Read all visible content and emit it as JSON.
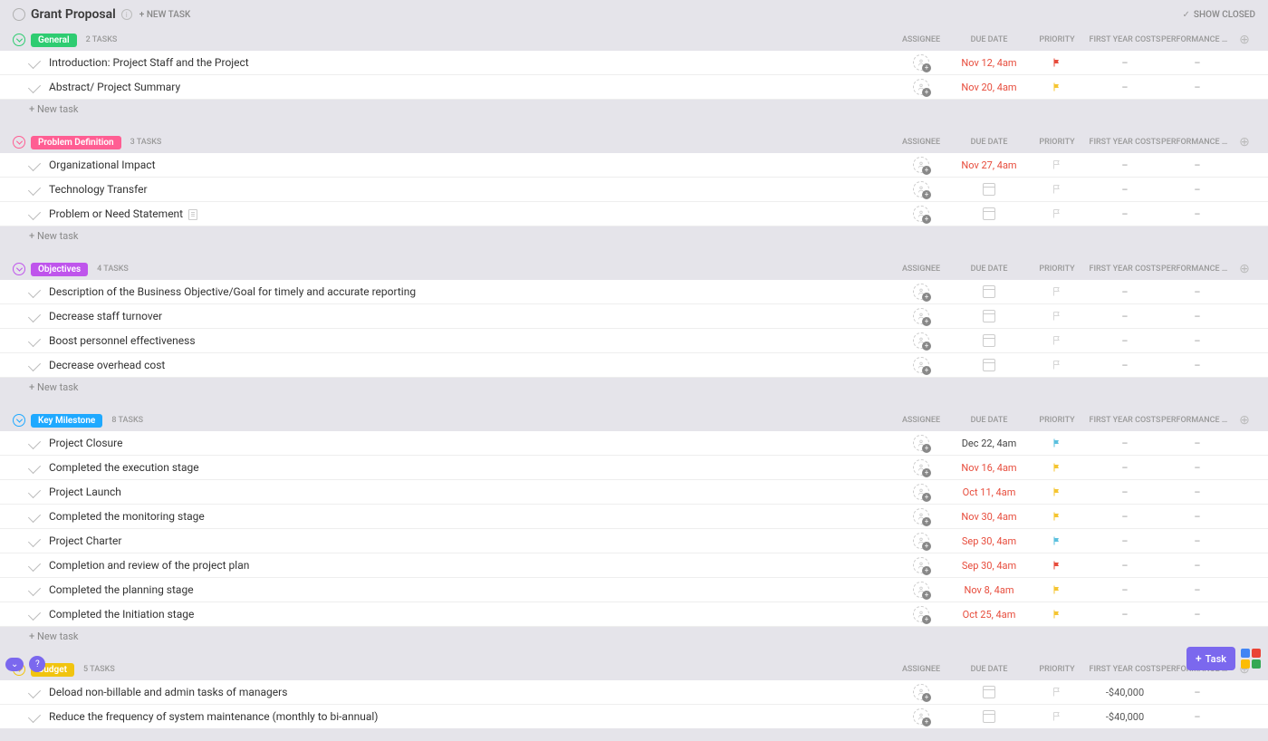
{
  "header": {
    "title": "Grant Proposal",
    "new_task": "+ NEW TASK",
    "show_closed": "SHOW CLOSED"
  },
  "columns": {
    "assignee": "ASSIGNEE",
    "due_date": "DUE DATE",
    "priority": "PRIORITY",
    "first_year": "FIRST YEAR COSTS",
    "performance": "PERFORMANCE M..."
  },
  "new_task_label": "+ New task",
  "fab": {
    "task": "Task"
  },
  "colors": {
    "general": "#2ecc71",
    "problem": "#ff5e93",
    "objectives": "#bf55ec",
    "milestone": "#1fa9ff",
    "budget": "#f1c40f"
  },
  "flag_colors": {
    "red": "#e74c3c",
    "yellow": "#f5c531",
    "blue": "#5bc0de",
    "grey": "#d6d6d6"
  },
  "groups": [
    {
      "id": "general",
      "label": "General",
      "count": "2 TASKS",
      "color_key": "general",
      "show_new": true,
      "tasks": [
        {
          "name": "Introduction: Project Staff and the Project",
          "due": "Nov 12, 4am",
          "due_style": "red",
          "flag": "red",
          "firstyear": "–",
          "perf": "–"
        },
        {
          "name": "Abstract/ Project Summary",
          "due": "Nov 20, 4am",
          "due_style": "red",
          "flag": "yellow",
          "firstyear": "–",
          "perf": "–"
        }
      ]
    },
    {
      "id": "problem",
      "label": "Problem Definition",
      "count": "3 TASKS",
      "color_key": "problem",
      "show_new": true,
      "tasks": [
        {
          "name": "Organizational Impact",
          "due": "Nov 27, 4am",
          "due_style": "red",
          "flag": "grey",
          "firstyear": "–",
          "perf": "–"
        },
        {
          "name": "Technology Transfer",
          "due": "",
          "due_style": "cal",
          "flag": "grey",
          "firstyear": "–",
          "perf": "–"
        },
        {
          "name": "Problem or Need Statement",
          "has_doc": true,
          "due": "",
          "due_style": "cal",
          "flag": "grey",
          "firstyear": "–",
          "perf": "–"
        }
      ]
    },
    {
      "id": "objectives",
      "label": "Objectives",
      "count": "4 TASKS",
      "color_key": "objectives",
      "show_new": true,
      "tasks": [
        {
          "name": "Description of the Business Objective/Goal for timely and accurate reporting",
          "due": "",
          "due_style": "cal",
          "flag": "grey",
          "firstyear": "–",
          "perf": "–"
        },
        {
          "name": "Decrease staff turnover",
          "due": "",
          "due_style": "cal",
          "flag": "grey",
          "firstyear": "–",
          "perf": "–"
        },
        {
          "name": "Boost personnel effectiveness",
          "due": "",
          "due_style": "cal",
          "flag": "grey",
          "firstyear": "–",
          "perf": "–"
        },
        {
          "name": "Decrease overhead cost",
          "due": "",
          "due_style": "cal",
          "flag": "grey",
          "firstyear": "–",
          "perf": "–"
        }
      ]
    },
    {
      "id": "milestone",
      "label": "Key Milestone",
      "count": "8 TASKS",
      "color_key": "milestone",
      "show_new": true,
      "tasks": [
        {
          "name": "Project Closure",
          "due": "Dec 22, 4am",
          "due_style": "black",
          "flag": "blue",
          "firstyear": "–",
          "perf": "–"
        },
        {
          "name": "Completed the execution stage",
          "due": "Nov 16, 4am",
          "due_style": "red",
          "flag": "yellow",
          "firstyear": "–",
          "perf": "–"
        },
        {
          "name": "Project Launch",
          "due": "Oct 11, 4am",
          "due_style": "red",
          "flag": "yellow",
          "firstyear": "–",
          "perf": "–"
        },
        {
          "name": "Completed the monitoring stage",
          "due": "Nov 30, 4am",
          "due_style": "red",
          "flag": "yellow",
          "firstyear": "–",
          "perf": "–"
        },
        {
          "name": "Project Charter",
          "due": "Sep 30, 4am",
          "due_style": "red",
          "flag": "blue",
          "firstyear": "–",
          "perf": "–"
        },
        {
          "name": "Completion and review of the project plan",
          "due": "Sep 30, 4am",
          "due_style": "red",
          "flag": "red",
          "firstyear": "–",
          "perf": "–"
        },
        {
          "name": "Completed the planning stage",
          "due": "Nov 8, 4am",
          "due_style": "red",
          "flag": "yellow",
          "firstyear": "–",
          "perf": "–"
        },
        {
          "name": "Completed the Initiation stage",
          "due": "Oct 25, 4am",
          "due_style": "red",
          "flag": "yellow",
          "firstyear": "–",
          "perf": "–"
        }
      ]
    },
    {
      "id": "budget",
      "label": "Budget",
      "count": "5 TASKS",
      "color_key": "budget",
      "show_new": false,
      "tasks": [
        {
          "name": "Deload non-billable and admin tasks of managers",
          "due": "",
          "due_style": "cal",
          "flag": "grey",
          "firstyear": "-$40,000",
          "perf": "–"
        },
        {
          "name": "Reduce the frequency of system maintenance (monthly to bi-annual)",
          "due": "",
          "due_style": "cal",
          "flag": "grey",
          "firstyear": "-$40,000",
          "perf": "–"
        }
      ]
    }
  ]
}
